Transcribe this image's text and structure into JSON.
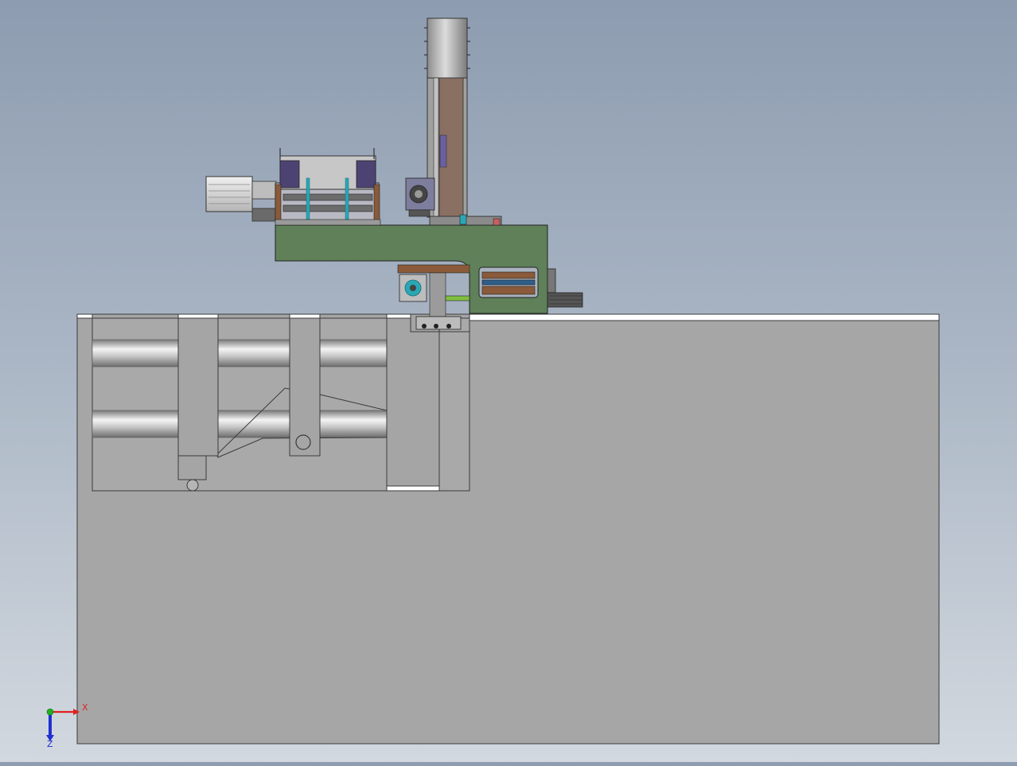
{
  "viewport": {
    "background_top": "#8d9cb0",
    "background_bottom": "#d2d8df"
  },
  "colors": {
    "base_fill": "#a5a5a5",
    "base_stroke": "#3a3a3a",
    "bracket_green": "#5f8059",
    "column_gray": "#9b9b9b",
    "column_slot": "#8a6f63",
    "accent_teal": "#2aa7b5",
    "accent_purple": "#6b5fa3",
    "accent_brown": "#8a5a3a",
    "motor_body": "#d9d9d9",
    "rod_highlight": "#f2f2f2",
    "axis_x": "#e02020",
    "axis_y": "#20b020",
    "axis_z": "#2030d0"
  },
  "triad": {
    "x_label": "X",
    "z_label": "Z"
  }
}
